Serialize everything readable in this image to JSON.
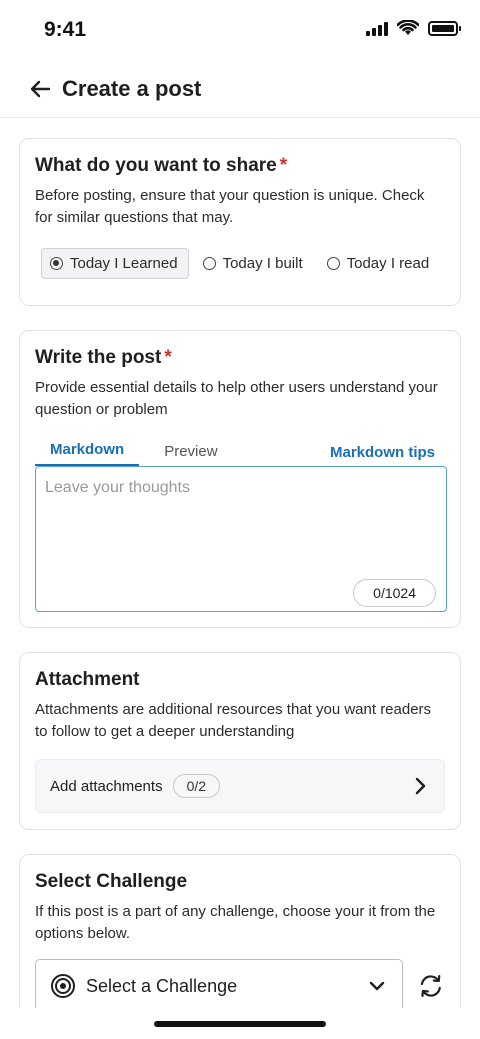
{
  "status_bar": {
    "time": "9:41"
  },
  "header": {
    "title": "Create a post"
  },
  "share": {
    "title": "What do you want to share",
    "required_mark": "*",
    "description": "Before posting, ensure that your question is unique. Check for similar questions that may.",
    "options": [
      {
        "label": "Today I Learned",
        "selected": true
      },
      {
        "label": "Today I built",
        "selected": false
      },
      {
        "label": "Today I read",
        "selected": false
      }
    ]
  },
  "write": {
    "title": "Write the post",
    "required_mark": "*",
    "description": "Provide essential details to help other users understand your question or problem",
    "tabs": [
      {
        "label": "Markdown",
        "active": true
      },
      {
        "label": "Preview",
        "active": false
      }
    ],
    "tips_link": "Markdown tips",
    "placeholder": "Leave your thoughts",
    "value": "",
    "counter": "0/1024"
  },
  "attachment": {
    "title": "Attachment",
    "description": "Attachments are additional resources that you want readers to follow to get a deeper understanding",
    "row_label": "Add attachments",
    "count": "0/2"
  },
  "challenge": {
    "title": "Select Challenge",
    "description": "If this post is a part of any challenge, choose your it from the options below.",
    "select_label": "Select a Challenge"
  },
  "colors": {
    "accent": "#1a6fb5",
    "required": "#d32f2f",
    "border": "#e3e3e3"
  }
}
